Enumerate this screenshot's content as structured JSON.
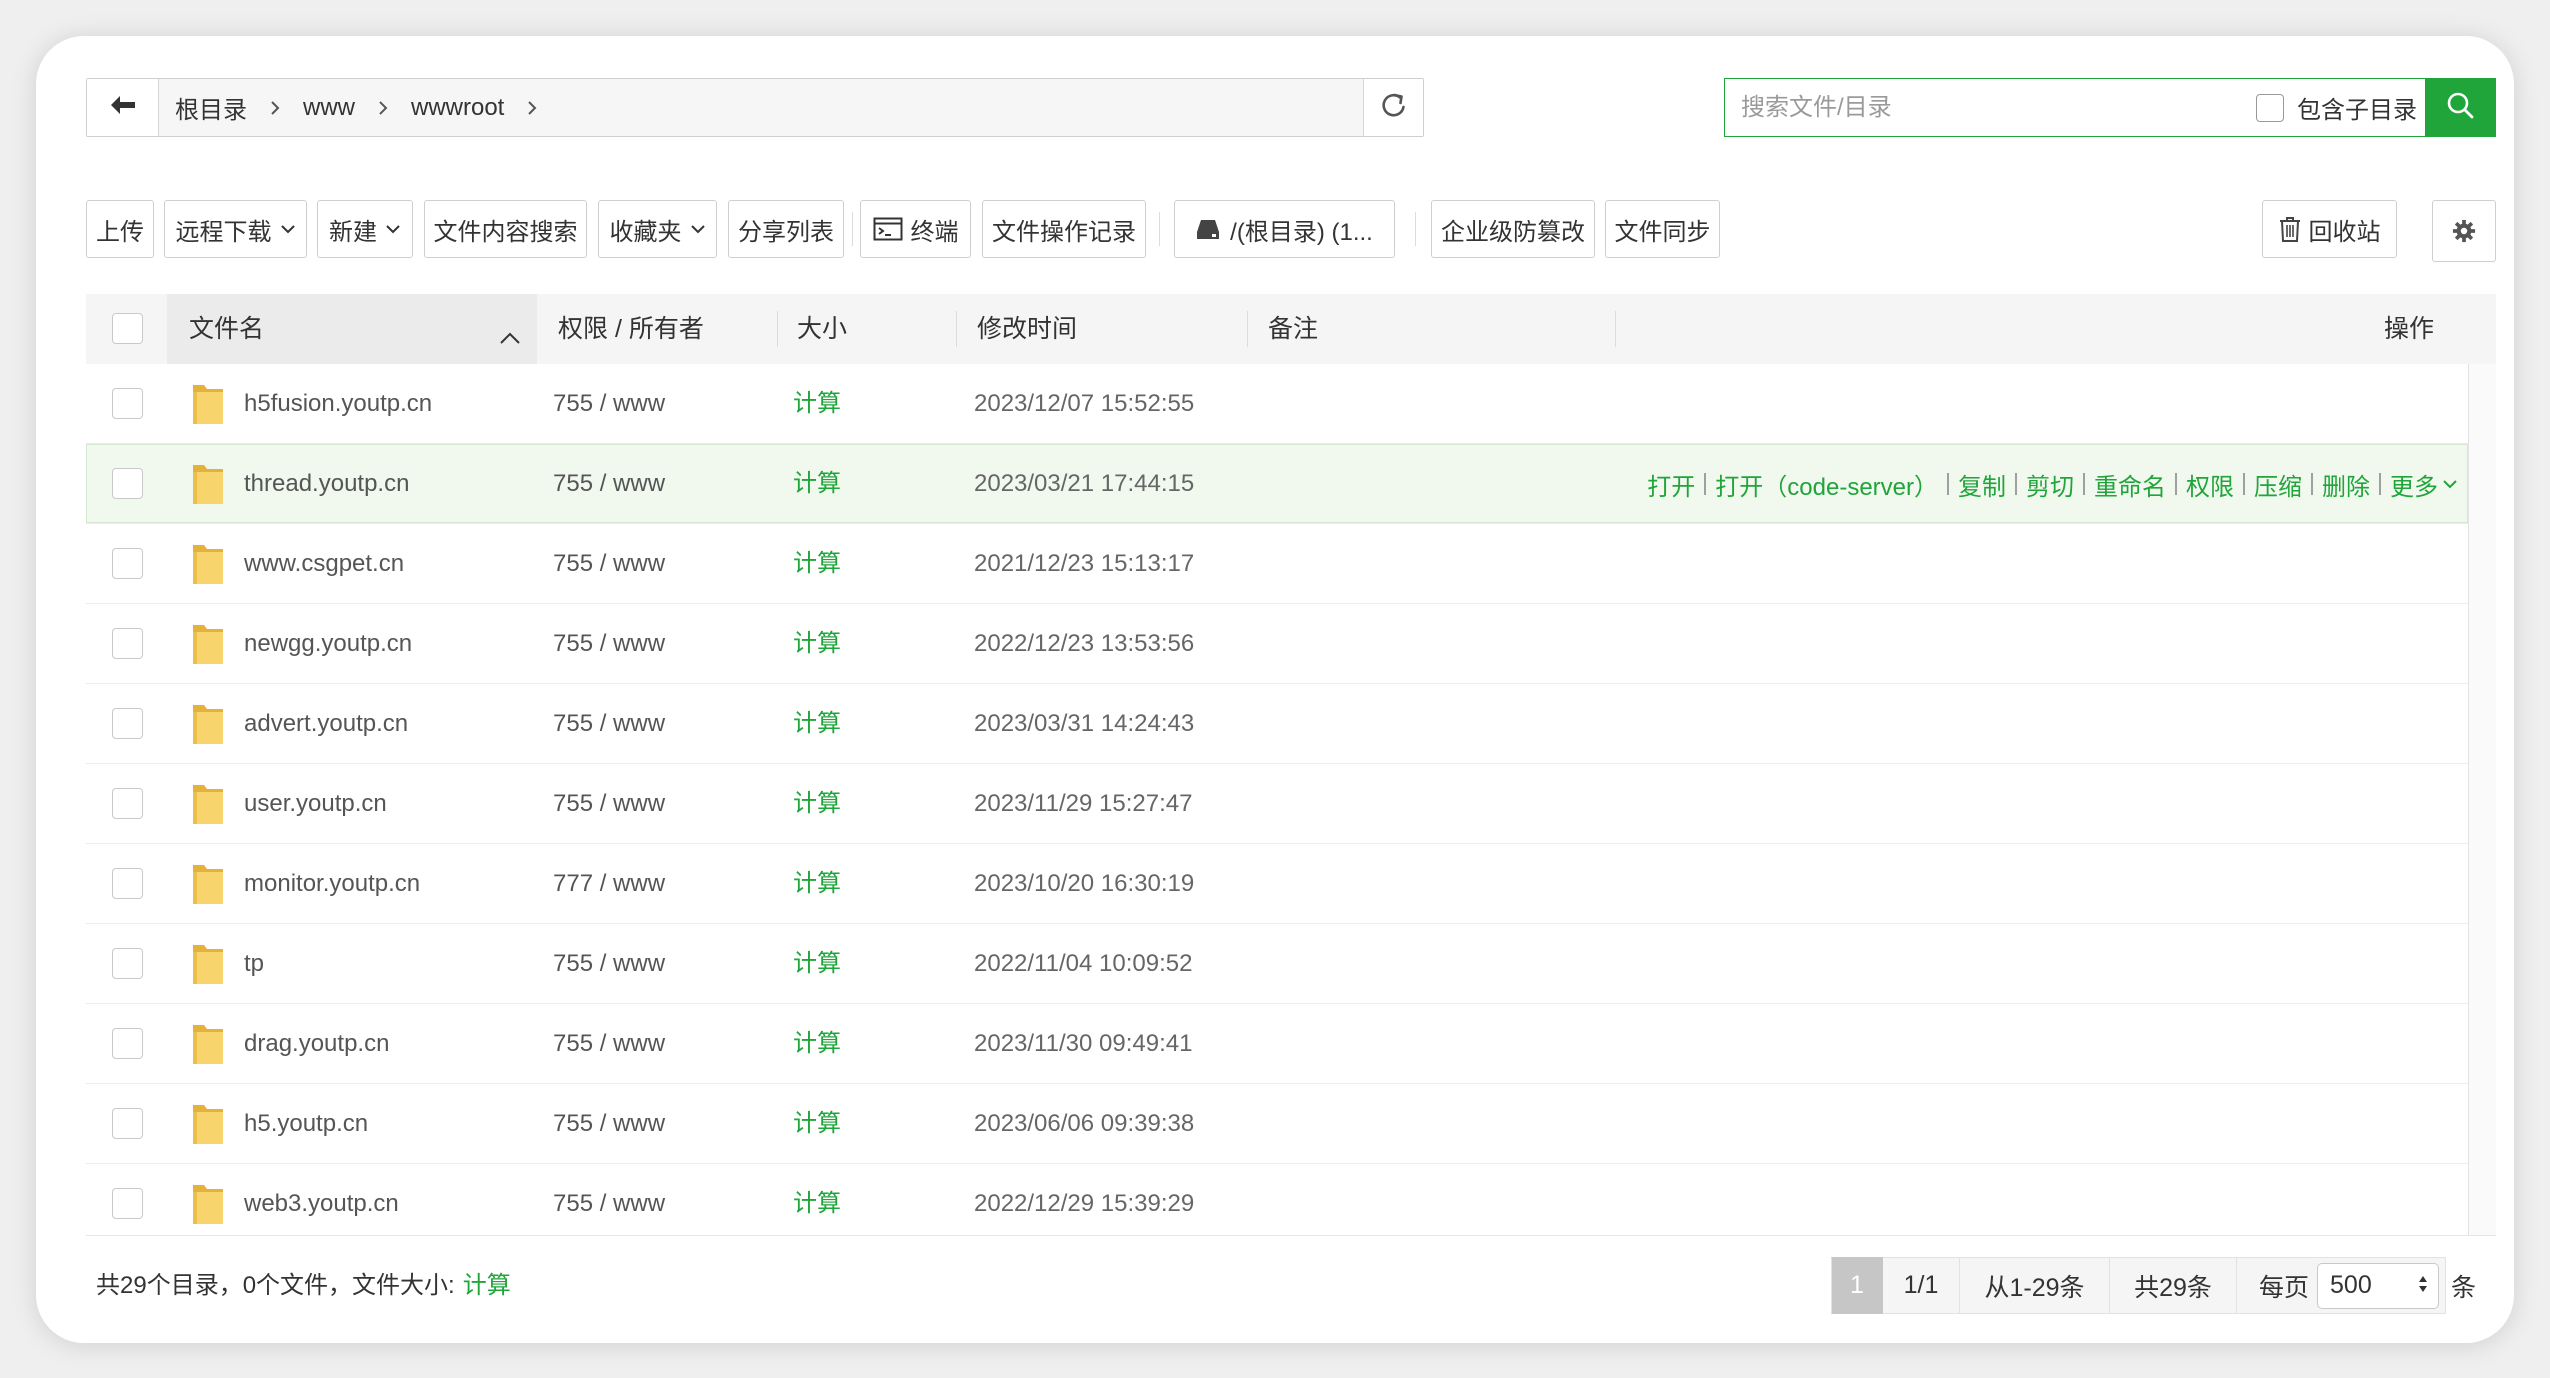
{
  "breadcrumb": {
    "items": [
      "根目录",
      "www",
      "wwwroot"
    ]
  },
  "search": {
    "placeholder": "搜索文件/目录",
    "include_subdirs_label": "包含子目录",
    "include_subdirs_checked": false
  },
  "toolbar": {
    "upload": "上传",
    "remote_download": "远程下载",
    "new": "新建",
    "content_search": "文件内容搜索",
    "favorites": "收藏夹",
    "share_list": "分享列表",
    "terminal": "终端",
    "operation_log": "文件操作记录",
    "disk": "/(根目录) (1...",
    "tamper_proof": "企业级防篡改",
    "file_sync": "文件同步",
    "recycle_bin": "回收站"
  },
  "table": {
    "headers": {
      "name": "文件名",
      "permission_owner": "权限 / 所有者",
      "size": "大小",
      "mtime": "修改时间",
      "remark": "备注",
      "actions": "操作"
    },
    "sort": {
      "column": "name",
      "direction": "asc"
    },
    "rows": [
      {
        "name": "h5fusion.youtp.cn",
        "perm": "755 / www",
        "size": "计算",
        "mtime": "2023/12/07 15:52:55"
      },
      {
        "name": "thread.youtp.cn",
        "perm": "755 / www",
        "size": "计算",
        "mtime": "2023/03/21 17:44:15"
      },
      {
        "name": "www.csgpet.cn",
        "perm": "755 / www",
        "size": "计算",
        "mtime": "2021/12/23 15:13:17"
      },
      {
        "name": "newgg.youtp.cn",
        "perm": "755 / www",
        "size": "计算",
        "mtime": "2022/12/23 13:53:56"
      },
      {
        "name": "advert.youtp.cn",
        "perm": "755 / www",
        "size": "计算",
        "mtime": "2023/03/31 14:24:43"
      },
      {
        "name": "user.youtp.cn",
        "perm": "755 / www",
        "size": "计算",
        "mtime": "2023/11/29 15:27:47"
      },
      {
        "name": "monitor.youtp.cn",
        "perm": "777 / www",
        "size": "计算",
        "mtime": "2023/10/20 16:30:19"
      },
      {
        "name": "tp",
        "perm": "755 / www",
        "size": "计算",
        "mtime": "2022/11/04 10:09:52"
      },
      {
        "name": "drag.youtp.cn",
        "perm": "755 / www",
        "size": "计算",
        "mtime": "2023/11/30 09:49:41"
      },
      {
        "name": "h5.youtp.cn",
        "perm": "755 / www",
        "size": "计算",
        "mtime": "2023/06/06 09:39:38"
      },
      {
        "name": "web3.youtp.cn",
        "perm": "755 / www",
        "size": "计算",
        "mtime": "2022/12/29 15:39:29"
      }
    ],
    "highlighted_row": 1,
    "row_actions": [
      "打开",
      "打开（code-server）",
      "复制",
      "剪切",
      "重命名",
      "权限",
      "压缩",
      "删除",
      "更多"
    ]
  },
  "footer": {
    "summary": "共29个目录，0个文件，文件大小:",
    "size_link": "计算",
    "pagination": {
      "current_page": "1",
      "page_of": "1/1",
      "range": "从1-29条",
      "total": "共29条",
      "per_page_label": "每页",
      "per_page_value": "500",
      "unit": "条"
    }
  },
  "icons": {
    "back": "arrow-left-icon",
    "refresh": "refresh-icon",
    "search": "search-icon",
    "terminal": "terminal-icon",
    "disk": "disk-icon",
    "recycle_bin": "trash-icon",
    "settings": "gear-icon",
    "folder": "folder-icon"
  },
  "colors": {
    "accent": "#20a53a"
  }
}
